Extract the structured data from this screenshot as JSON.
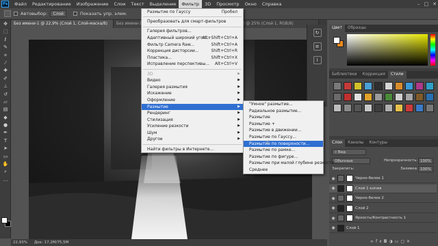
{
  "menubar": {
    "logo": "Ps",
    "items": [
      "Файл",
      "Редактирование",
      "Изображение",
      "Слои",
      "Текст",
      "Выделение",
      "Фильтр",
      "3D",
      "Просмотр",
      "Окно",
      "Справка"
    ],
    "active_index": 6
  },
  "options": {
    "autoselect_label": "Автовыбор:",
    "autoselect_value": "Слой",
    "show_controls_label": "Показать упр. элем."
  },
  "tabs": [
    "Без имени-1 @ 22,9% (Слой 1, Слой-маска/8)",
    "Без имени-1 @ 19,7% (Слой 1, RGB/8)",
    "Без имени-2 @ 25% (Слой 1, RGB/8)"
  ],
  "status": {
    "zoom": "22,93%",
    "doc": "Док: 17,2М/75,5М"
  },
  "filter_menu": {
    "items": [
      {
        "label": "Размытие по Гауссу",
        "shortcut": "Пробел"
      },
      {
        "sep": true
      },
      {
        "label": "Преобразовать для смарт-фильтров"
      },
      {
        "sep": true
      },
      {
        "label": "Галерея фильтров..."
      },
      {
        "label": "Адаптивный широкий угол...",
        "shortcut": "Alt+Shift+Ctrl+A"
      },
      {
        "label": "Фильтр Camera Raw...",
        "shortcut": "Shift+Ctrl+A"
      },
      {
        "label": "Коррекция дисторсии...",
        "shortcut": "Shift+Ctrl+R"
      },
      {
        "label": "Пластика...",
        "shortcut": "Shift+Ctrl+X"
      },
      {
        "label": "Исправление перспективы...",
        "shortcut": "Alt+Ctrl+V"
      },
      {
        "sep": true
      },
      {
        "label": "3D",
        "sub": true,
        "disabled": true
      },
      {
        "label": "Видео",
        "sub": true
      },
      {
        "label": "Галерея размытия",
        "sub": true
      },
      {
        "label": "Искажение",
        "sub": true
      },
      {
        "label": "Оформление",
        "sub": true
      },
      {
        "label": "Размытие",
        "sub": true,
        "highlight": true
      },
      {
        "label": "Рендеринг",
        "sub": true
      },
      {
        "label": "Стилизация",
        "sub": true
      },
      {
        "label": "Усиление резкости",
        "sub": true
      },
      {
        "label": "Шум",
        "sub": true
      },
      {
        "label": "Другое",
        "sub": true
      },
      {
        "sep": true
      },
      {
        "label": "Найти фильтры в Интернете..."
      }
    ]
  },
  "blur_submenu": {
    "items": [
      {
        "label": "\"Умное\" размытие..."
      },
      {
        "label": "Радиальное размытие..."
      },
      {
        "label": "Размытие"
      },
      {
        "label": "Размытие +"
      },
      {
        "label": "Размытие в движении..."
      },
      {
        "label": "Размытие по Гауссу..."
      },
      {
        "label": "Размытие по поверхности...",
        "highlight": true
      },
      {
        "label": "Размытие по рамке..."
      },
      {
        "label": "Размытие по фигуре..."
      },
      {
        "label": "Размытие при малой глубине резкости..."
      },
      {
        "label": "Среднее"
      }
    ]
  },
  "color_panel": {
    "tabs": [
      "Цвет",
      "Образцы"
    ]
  },
  "styles_panel": {
    "tabs": [
      "Библиотеки",
      "Коррекция",
      "Стили"
    ]
  },
  "layers_panel": {
    "tabs": [
      "Слои",
      "Каналы",
      "Контуры"
    ],
    "kind_label": "Вид",
    "blend_mode": "Обычные",
    "opacity_label": "Непрозрачность:",
    "opacity_value": "100%",
    "lock_label": "Закрепить:",
    "fill_label": "Заливка:",
    "fill_value": "100%",
    "layers": [
      {
        "name": "Черно-белое 1",
        "thumb": "adj",
        "mask": true
      },
      {
        "name": "Слой 1 копия",
        "thumb": "dark",
        "mask": true,
        "selected": true
      },
      {
        "name": "Черно-белое 2",
        "thumb": "adj",
        "mask": true
      },
      {
        "name": "Слой 2",
        "thumb": "dark",
        "mask": true
      },
      {
        "name": "Яркость/Контрастность 1",
        "thumb": "adj",
        "mask": true
      },
      {
        "name": "Слой 1",
        "thumb": "dark",
        "mask": false
      }
    ]
  },
  "colors": {
    "menu_highlight": "#2f6fd1",
    "foreground_swatch": "#ffffff",
    "background_swatch": "#000000",
    "picker_hue": "#e6e600",
    "accent_swatch": "#f08a1c"
  }
}
